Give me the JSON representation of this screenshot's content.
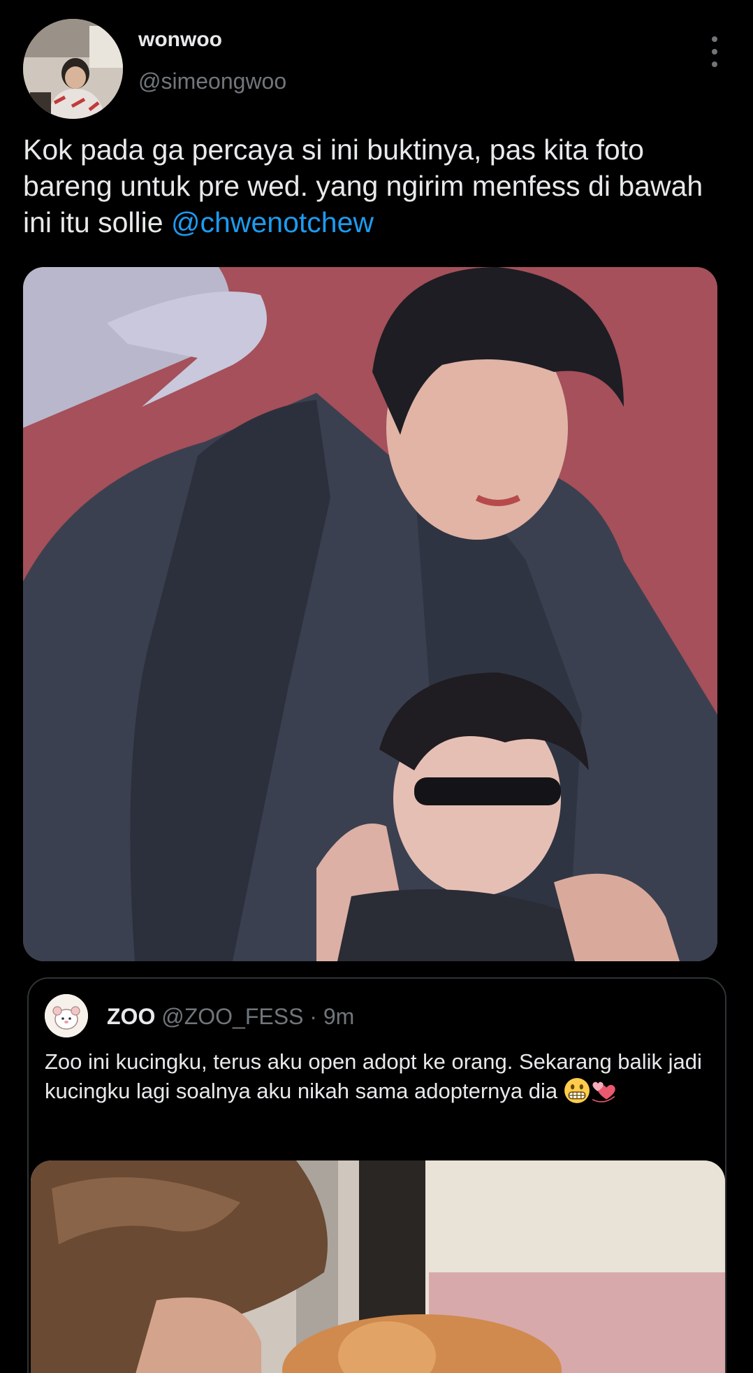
{
  "tweet": {
    "author": {
      "display_name": "wonwoo",
      "handle": "@simeongwoo",
      "avatar_icon": "profile-photo"
    },
    "more_icon": "more-vertical-icon",
    "text_before_mention": "Kok pada ga percaya si ini buktinya, pas kita foto bareng untuk pre wed. yang ngirim menfess di bawah ini itu sollie ",
    "mention": "@chwenotchew",
    "media": "photo of two people posing in leather jackets against a red backdrop"
  },
  "quote": {
    "display_name": "ZOO",
    "handle": "@ZOO_FESS",
    "separator": " · ",
    "time": "9m",
    "avatar_icon": "zoo-fess-logo",
    "text": "Zoo ini kucingku, terus aku open adopt ke orang. Sekarang balik jadi kucingku lagi soalnya aku nikah sama adopternya dia ",
    "emojis": [
      "grimacing-face-icon",
      "revolving-hearts-icon"
    ],
    "media": "photo of a person with an orange cat"
  },
  "colors": {
    "background": "#000000",
    "text": "#e7e9ea",
    "secondary": "#71767b",
    "link": "#1d9bf0",
    "border": "#2f3336"
  }
}
